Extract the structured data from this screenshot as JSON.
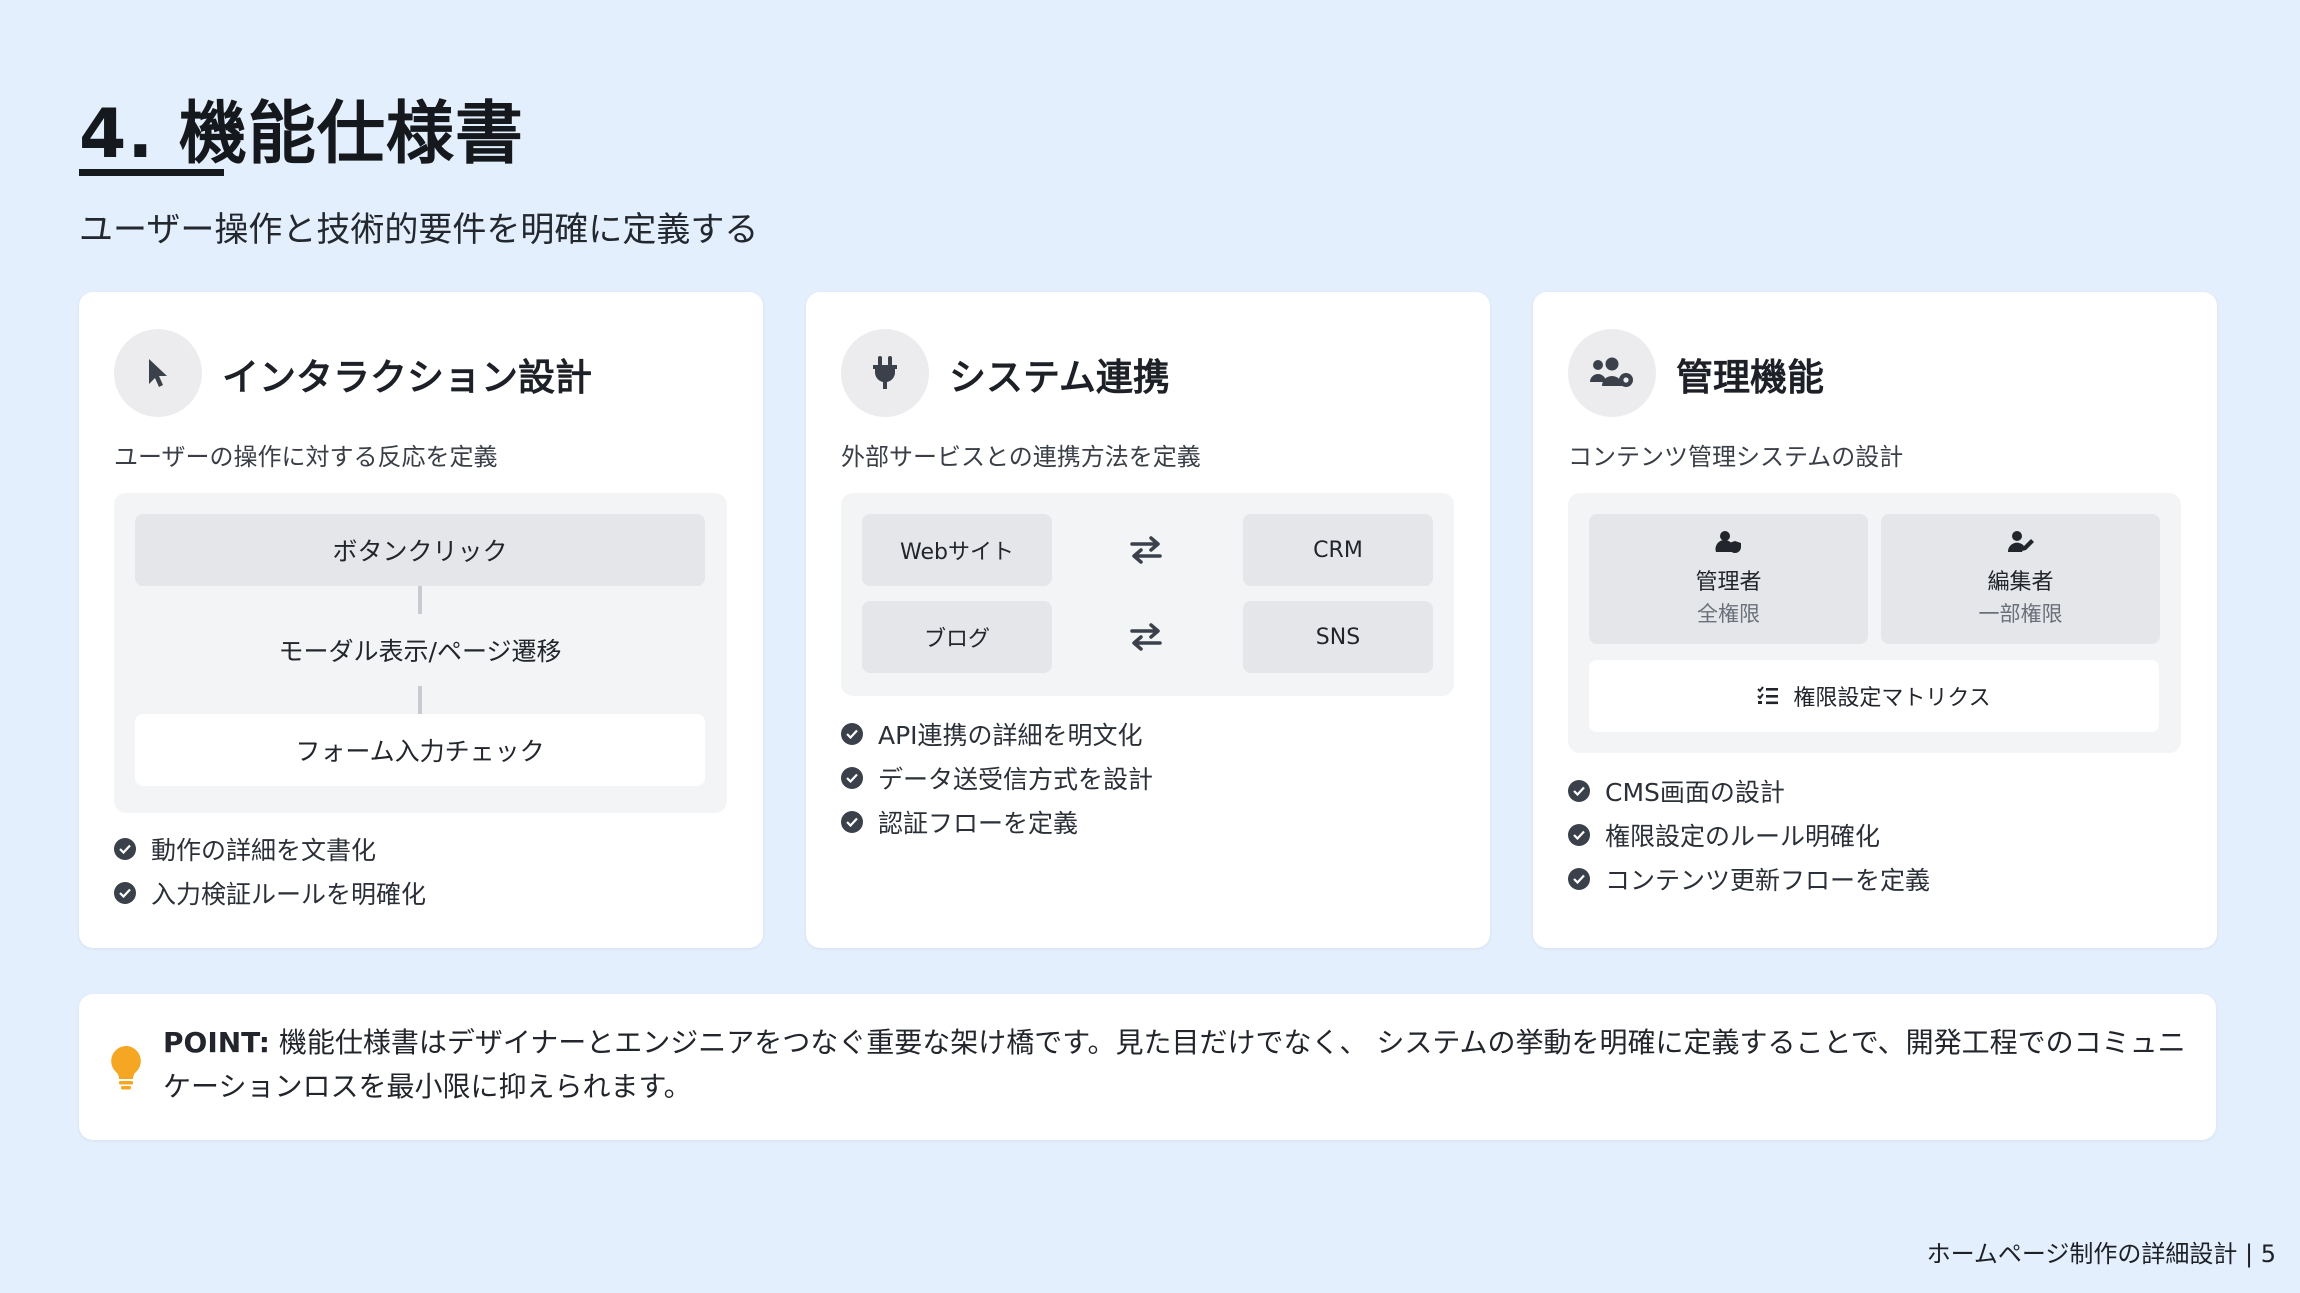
{
  "slide": {
    "title": "4. 機能仕様書",
    "subtitle": "ユーザー操作と技術的要件を明確に定義する",
    "footer": "ホームページ制作の詳細設計 | 5"
  },
  "cards": [
    {
      "icon": "cursor-pointer-icon",
      "title": "インタラクション設計",
      "description": "ユーザーの操作に対する反応を定義",
      "flow": [
        "ボタンクリック",
        "モーダル表示/ページ遷移",
        "フォーム入力チェック"
      ],
      "bullets": [
        "動作の詳細を文書化",
        "入力検証ルールを明確化"
      ]
    },
    {
      "icon": "plug-icon",
      "title": "システム連携",
      "description": "外部サービスとの連携方法を定義",
      "connections": [
        {
          "from": "Webサイト",
          "to": "CRM"
        },
        {
          "from": "ブログ",
          "to": "SNS"
        }
      ],
      "bullets": [
        "API連携の詳細を明文化",
        "データ送受信方式を設計",
        "認証フローを定義"
      ]
    },
    {
      "icon": "users-gear-icon",
      "title": "管理機能",
      "description": "コンテンツ管理システムの設計",
      "roles": [
        {
          "name": "管理者",
          "permission": "全権限",
          "icon": "user-shield-icon"
        },
        {
          "name": "編集者",
          "permission": "一部権限",
          "icon": "user-pen-icon"
        }
      ],
      "matrix_label": "権限設定マトリクス",
      "bullets": [
        "CMS画面の設計",
        "権限設定のルール明確化",
        "コンテンツ更新フローを定義"
      ]
    }
  ],
  "point": {
    "label": "POINT:",
    "text": " 機能仕様書はデザイナーとエンジニアをつなぐ重要な架け橋です。見た目だけでなく、 システムの挙動を明確に定義することで、開発工程でのコミュニケーションロスを最小限に抑えられます。",
    "icon": "lightbulb-icon"
  },
  "colors": {
    "background": "#e4effd",
    "card": "#ffffff",
    "panel": "#f3f4f6",
    "box": "#e5e6e9",
    "text": "#1f2329",
    "accent": "#f5a623"
  }
}
